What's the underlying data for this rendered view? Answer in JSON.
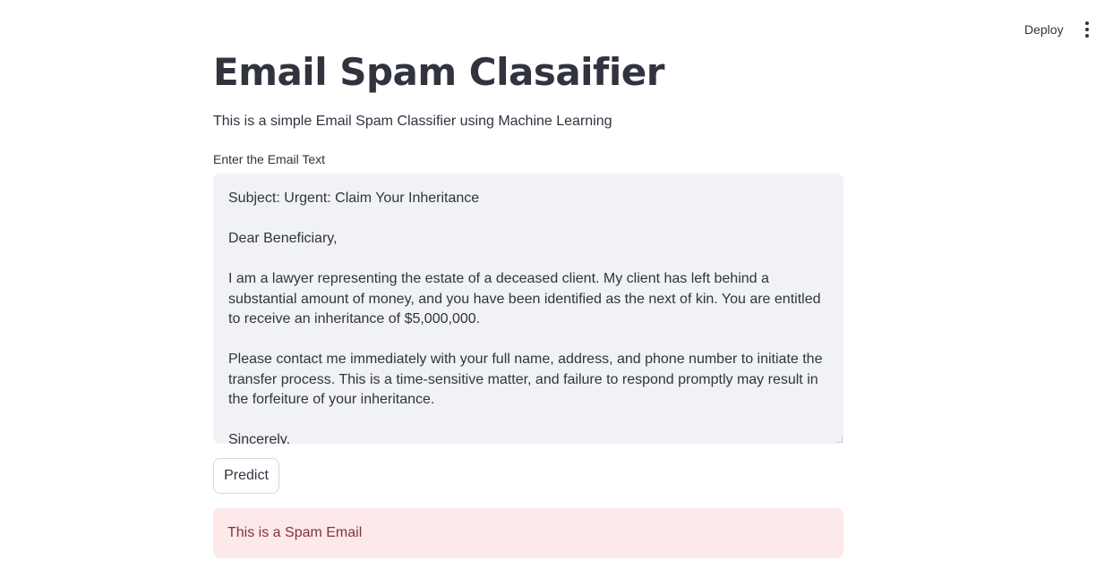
{
  "header": {
    "deploy_label": "Deploy",
    "menu_icon": "more-vertical-icon"
  },
  "main": {
    "title": "Email Spam Clasaifier",
    "subtitle": "This is a simple Email Spam Classifier using Machine Learning",
    "input_label": "Enter the Email Text",
    "email_text": "Subject: Urgent: Claim Your Inheritance\n\nDear Beneficiary,\n\nI am a lawyer representing the estate of a deceased client. My client has left behind a substantial amount of money, and you have been identified as the next of kin. You are entitled to receive an inheritance of $5,000,000.\n\nPlease contact me immediately with your full name, address, and phone number to initiate the transfer process. This is a time-sensitive matter, and failure to respond promptly may result in the forfeiture of your inheritance.\n\nSincerely,",
    "predict_label": "Predict",
    "result_text": "This is a Spam Email"
  },
  "colors": {
    "text": "#31333f",
    "input_bg": "#f0f2f6",
    "error_bg": "#fde9ea",
    "error_text": "#7d353b"
  }
}
